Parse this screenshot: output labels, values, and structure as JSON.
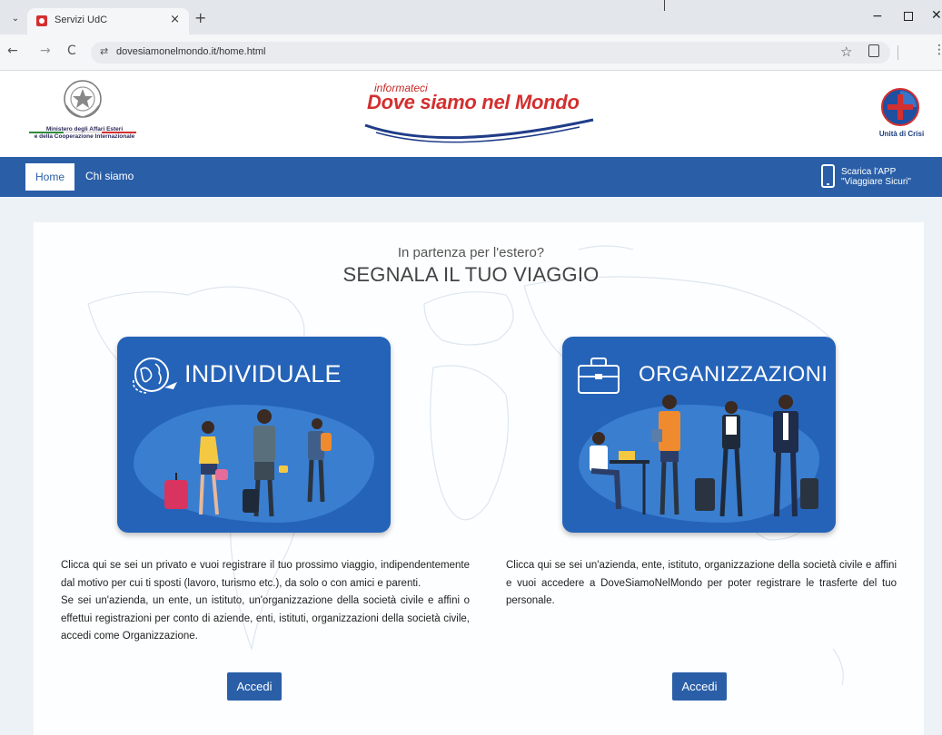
{
  "browser": {
    "tab_title": "Servizi UdC",
    "tab_close": "×",
    "new_tab": "+",
    "url": "dovesiamonelmondo.it/home.html",
    "back": "←",
    "forward": "→",
    "reload": "C",
    "site_info": "⇄",
    "tab_menu": "⌄",
    "star": "☆",
    "menu": "⋮",
    "min": "−",
    "close": "✕"
  },
  "header": {
    "ministry_name_line1": "Ministero degli Affari Esteri",
    "ministry_name_line2": "e della Cooperazione Internazionale",
    "logo_small": "informateci",
    "logo_main": "Dove siamo nel Mondo",
    "crisis_name": "Unità di Crisi"
  },
  "nav": {
    "home": "Home",
    "chi_siamo": "Chi siamo",
    "app_line1": "Scarica l'APP",
    "app_line2": "\"Viaggiare Sicuri\""
  },
  "hero": {
    "subtitle": "In partenza per l'estero?",
    "title": "SEGNALA IL TUO VIAGGIO"
  },
  "cards": {
    "individuale": {
      "title": "INDIVIDUALE",
      "desc_p1": "Clicca qui se sei un privato e vuoi registrare il tuo prossimo viaggio, indipendentemente dal motivo per cui ti sposti (lavoro, turismo etc.), da solo o con amici e parenti.",
      "desc_p2": "Se sei un'azienda, un ente, un istituto, un'organizzazione della società civile e affini o effettui registrazioni per conto di aziende, enti, istituti, organizzazioni della società civile, accedi come Organizzazione.",
      "button": "Accedi"
    },
    "organizzazioni": {
      "title": "ORGANIZZAZIONI",
      "desc_p1": "Clicca qui se sei un'azienda, ente, istituto, organizzazione della società civile e affini e vuoi accedere a DoveSiamoNelMondo per poter registrare le trasferte del tuo personale.",
      "button": "Accedi"
    }
  },
  "colors": {
    "brand_blue": "#2a5fa8",
    "card_blue": "#2563b8",
    "logo_red": "#d32f2f"
  }
}
